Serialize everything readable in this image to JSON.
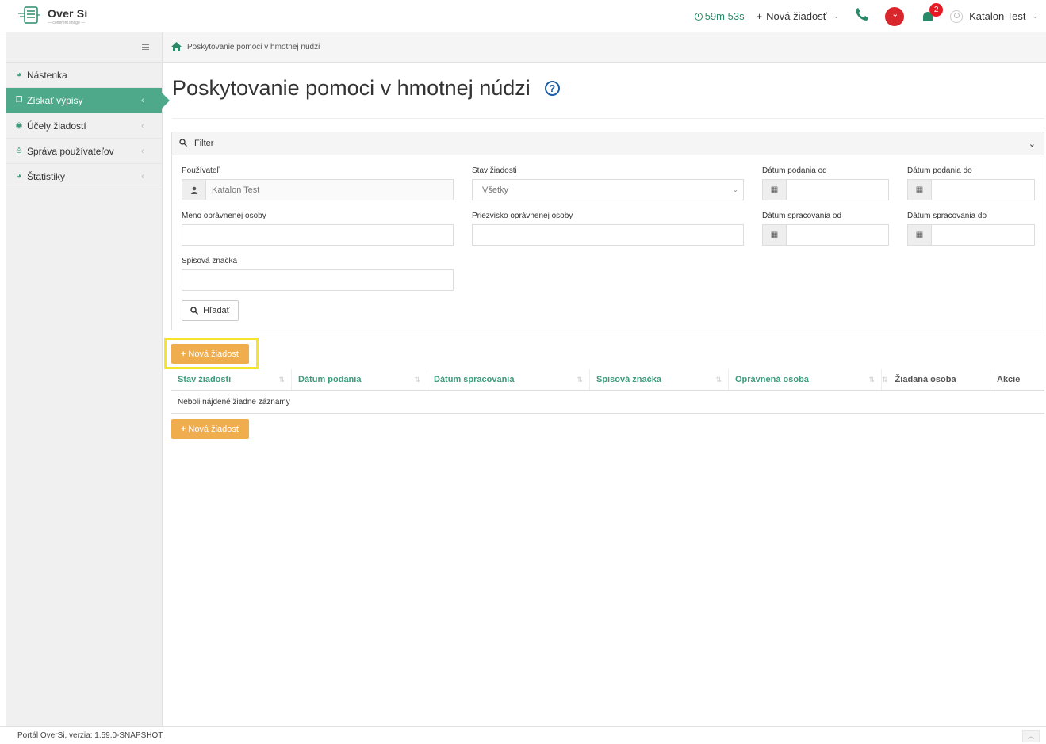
{
  "app": {
    "title": "Over Si",
    "subtitle": "— cohérent image —"
  },
  "topbar": {
    "timer": "59m 53s",
    "new_request": "Nová žiadosť",
    "notification_count": "2",
    "user_name": "Katalon Test",
    "icons": [
      "clock-icon",
      "plus-icon",
      "phone-icon",
      "bell-icon",
      "user-icon"
    ],
    "accent_color": "#2a8a68",
    "alert_color": "#d9262c"
  },
  "sidebar": {
    "items": [
      {
        "label": "Nástenka",
        "icon": "dashboard-icon",
        "active": false
      },
      {
        "label": "Získať výpisy",
        "icon": "copy-icon",
        "active": true
      },
      {
        "label": "Účely žiadostí",
        "icon": "circle-icon",
        "active": false
      },
      {
        "label": "Správa používateľov",
        "icon": "users-icon",
        "active": false
      },
      {
        "label": "Štatistiky",
        "icon": "dashboard-icon",
        "active": false
      }
    ],
    "active_color": "#4ea98a"
  },
  "breadcrumb": {
    "text": "Poskytovanie pomoci v hmotnej núdzi"
  },
  "page": {
    "title": "Poskytovanie pomoci v hmotnej núdzi"
  },
  "filter": {
    "header": "Filter",
    "user_label": "Používateľ",
    "user_value": "Katalon Test",
    "status_label": "Stav žiadosti",
    "status_value": "Všetky",
    "submit_from_label": "Dátum podania od",
    "submit_to_label": "Dátum podania do",
    "entitled_name_label": "Meno oprávnenej osoby",
    "entitled_surname_label": "Priezvisko oprávnenej osoby",
    "process_from_label": "Dátum spracovania od",
    "process_to_label": "Dátum spracovania do",
    "file_ref_label": "Spisová značka",
    "search_button": "Hľadať"
  },
  "actions": {
    "new_request": "Nová žiadosť",
    "button_color": "#f0ad4e"
  },
  "table": {
    "columns": [
      "Stav žiadosti",
      "Dátum podania",
      "Dátum spracovania",
      "Spisová značka",
      "Oprávnená osoba",
      "Žiadaná osoba",
      "Akcie"
    ],
    "empty_message": "Neboli nájdené žiadne záznamy"
  },
  "footer": {
    "version": "Portál OverSi, verzia: 1.59.0-SNAPSHOT"
  }
}
